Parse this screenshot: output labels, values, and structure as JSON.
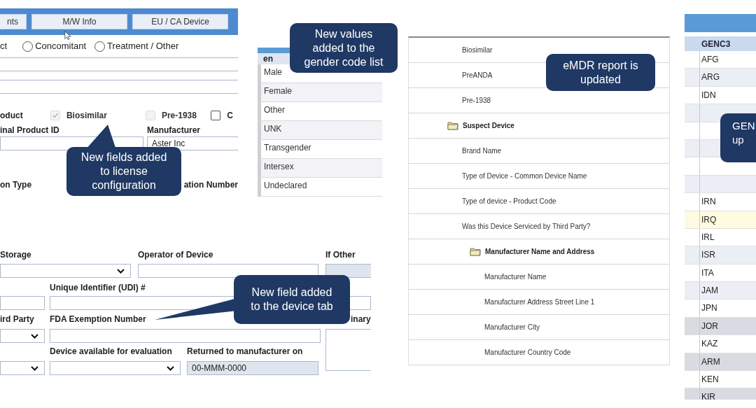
{
  "license_form": {
    "tabs": [
      {
        "label": "nts"
      },
      {
        "label": "M/W Info"
      },
      {
        "label": "EU / CA Device"
      }
    ],
    "radios": [
      {
        "label": "ct"
      },
      {
        "label": "Concomitant",
        "selected": false
      },
      {
        "label": "Treatment / Other",
        "selected": false
      }
    ],
    "row_label": "oduct",
    "checkboxes": [
      {
        "label": "Biosimilar",
        "checked": true,
        "disabled": true
      },
      {
        "label": "Pre-1938",
        "checked": false,
        "disabled": true
      },
      {
        "label": "C",
        "checked": false,
        "disabled": false
      }
    ],
    "fields": [
      {
        "label": "inal Product ID"
      },
      {
        "label": "Manufacturer",
        "value": "Aster Inc"
      }
    ],
    "bottom_labels": [
      "on Type",
      "ation Number"
    ],
    "callout": "New fields added\nto license\nconfiguration"
  },
  "device_form": {
    "labels_1": [
      "Storage",
      "Operator of Device",
      "If Other"
    ],
    "labels_2": [
      "Unique Identifier (UDI) #"
    ],
    "labels_3": [
      "ird Party",
      "FDA Exemption Number",
      "inary"
    ],
    "labels_4": [
      "Device available for evaluation",
      "Returned to manufacturer on"
    ],
    "returned_value": "00-MMM-0000",
    "callout": "New field added\nto the device tab"
  },
  "gender_list": {
    "header": "en",
    "rows": [
      "Male",
      "Female",
      "Other",
      "UNK",
      "Transgender",
      "Intersex",
      "Undeclared"
    ],
    "callout": "New values\nadded to the\ngender code list"
  },
  "emdr_report": {
    "callout": "eMDR report is\nupdated",
    "tree": [
      {
        "kind": "group",
        "children": [
          {
            "kind": "leaf",
            "label": "Biosimilar"
          },
          {
            "kind": "leaf",
            "label": "PreANDA"
          },
          {
            "kind": "leaf",
            "label": "Pre-1938"
          }
        ]
      },
      {
        "kind": "folder",
        "label": "Suspect Device",
        "children": [
          {
            "kind": "leaf",
            "label": "Brand Name"
          },
          {
            "kind": "leaf",
            "label": "Type of Device - Common Device Name"
          },
          {
            "kind": "leaf",
            "label": "Type of device - Product Code"
          },
          {
            "kind": "leaf",
            "label": "Was this Device Serviced by Third Party?"
          },
          {
            "kind": "folder",
            "label": "Manufacturer Name and Address",
            "children": [
              {
                "kind": "leaf",
                "label": "Manufacturer Name"
              },
              {
                "kind": "leaf",
                "label": "Manufacturer Address Street Line 1"
              },
              {
                "kind": "leaf",
                "label": "Manufacturer City"
              },
              {
                "kind": "leaf",
                "label": "Manufacturer Country Code"
              }
            ]
          }
        ]
      }
    ]
  },
  "genc_table": {
    "header": "GENC3",
    "callout": "GEN\nup",
    "rows": [
      {
        "kind": "code",
        "code": "AFG",
        "selected": false
      },
      {
        "kind": "code",
        "code": "ARG",
        "selected": false
      },
      {
        "kind": "code",
        "code": "IDN",
        "selected": false
      },
      {
        "kind": "blank",
        "selected": false
      },
      {
        "kind": "blank",
        "selected": false
      },
      {
        "kind": "blank",
        "selected": false
      },
      {
        "kind": "blank",
        "selected": false
      },
      {
        "kind": "blank",
        "selected": false
      },
      {
        "kind": "code",
        "code": "IRN",
        "selected": false
      },
      {
        "kind": "code",
        "code": "IRQ",
        "selected": true
      },
      {
        "kind": "code",
        "code": "IRL",
        "selected": false
      },
      {
        "kind": "code",
        "code": "ISR",
        "selected": false
      },
      {
        "kind": "code",
        "code": "ITA",
        "selected": false
      },
      {
        "kind": "code",
        "code": "JAM",
        "selected": false
      },
      {
        "kind": "code",
        "code": "JPN",
        "selected": false
      },
      {
        "kind": "code",
        "code": "JOR",
        "selected": false
      },
      {
        "kind": "code",
        "code": "KAZ",
        "selected": false
      },
      {
        "kind": "code",
        "code": "ARM",
        "selected": false
      },
      {
        "kind": "code",
        "code": "KEN",
        "selected": false
      },
      {
        "kind": "code",
        "code": "KIR",
        "selected": false
      }
    ]
  }
}
